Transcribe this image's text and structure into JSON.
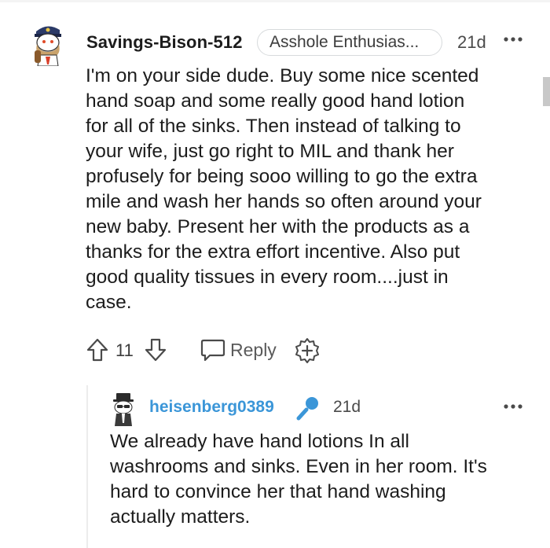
{
  "comment": {
    "author": "Savings-Bison-512",
    "flair": "Asshole Enthusias...",
    "time": "21d",
    "more_icon": "more-horizontal-icon",
    "avatar_icon": "snoo-avatar-captain",
    "body_lines": [
      "I'm on your side dude. Buy some nice scented",
      "hand soap and some really good hand lotion",
      "for all of the sinks. Then instead of talking to",
      "your wife, just go right to MIL and thank her",
      "profusely for being sooo willing to go the extra",
      "mile and wash her hands so often around your",
      "new baby. Present her with the products as a",
      "thanks for the extra effort incentive. Also put",
      "good quality tissues in every room....just in",
      "case."
    ],
    "actions": {
      "upvote_icon": "upvote-arrow-icon",
      "score": "11",
      "downvote_icon": "downvote-arrow-icon",
      "reply_icon": "reply-bubble-icon",
      "reply_label": "Reply",
      "award_icon": "award-plus-icon"
    }
  },
  "reply": {
    "author": "heisenberg0389",
    "author_color": "#3b96d8",
    "badge_icon": "microphone-op-icon",
    "time": "21d",
    "more_icon": "more-horizontal-icon",
    "avatar_icon": "snoo-avatar-suit",
    "body_lines": [
      "We already have hand lotions In all",
      "washrooms and sinks. Even in her room. It's",
      "hard to convince her that hand washing",
      "actually matters."
    ]
  },
  "colors": {
    "text": "#1c1c1c",
    "meta": "#4a4a4a",
    "op_blue": "#3b96d8",
    "flair_border": "#d7dadc"
  }
}
